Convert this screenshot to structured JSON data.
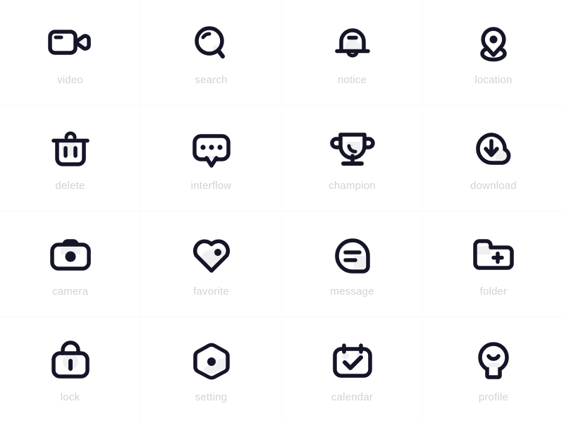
{
  "page": {
    "background_color": "#ffffff",
    "grid_line_color": "#f7f7f8",
    "icon_color": "#141527",
    "icon_accent_color": "#f0f0f2",
    "label_color": "#d2d2d7",
    "columns": 4,
    "rows": 4
  },
  "icons": [
    {
      "id": "video",
      "label": "video",
      "icon_name": "video-camera-icon"
    },
    {
      "id": "search",
      "label": "search",
      "icon_name": "search-icon"
    },
    {
      "id": "notice",
      "label": "notice",
      "icon_name": "bell-icon"
    },
    {
      "id": "location",
      "label": "location",
      "icon_name": "location-pin-icon"
    },
    {
      "id": "delete",
      "label": "delete",
      "icon_name": "trash-icon"
    },
    {
      "id": "interflow",
      "label": "interflow",
      "icon_name": "chat-bubble-icon"
    },
    {
      "id": "champion",
      "label": "champion",
      "icon_name": "trophy-icon"
    },
    {
      "id": "download",
      "label": "download",
      "icon_name": "cloud-download-icon"
    },
    {
      "id": "camera",
      "label": "camera",
      "icon_name": "camera-icon"
    },
    {
      "id": "favorite",
      "label": "favorite",
      "icon_name": "heart-icon"
    },
    {
      "id": "message",
      "label": "message",
      "icon_name": "message-icon"
    },
    {
      "id": "folder",
      "label": "folder",
      "icon_name": "folder-add-icon"
    },
    {
      "id": "lock",
      "label": "lock",
      "icon_name": "lock-icon"
    },
    {
      "id": "setting",
      "label": "setting",
      "icon_name": "hexagon-setting-icon"
    },
    {
      "id": "calendar",
      "label": "calendar",
      "icon_name": "calendar-check-icon"
    },
    {
      "id": "profile",
      "label": "profile",
      "icon_name": "profile-icon"
    }
  ]
}
